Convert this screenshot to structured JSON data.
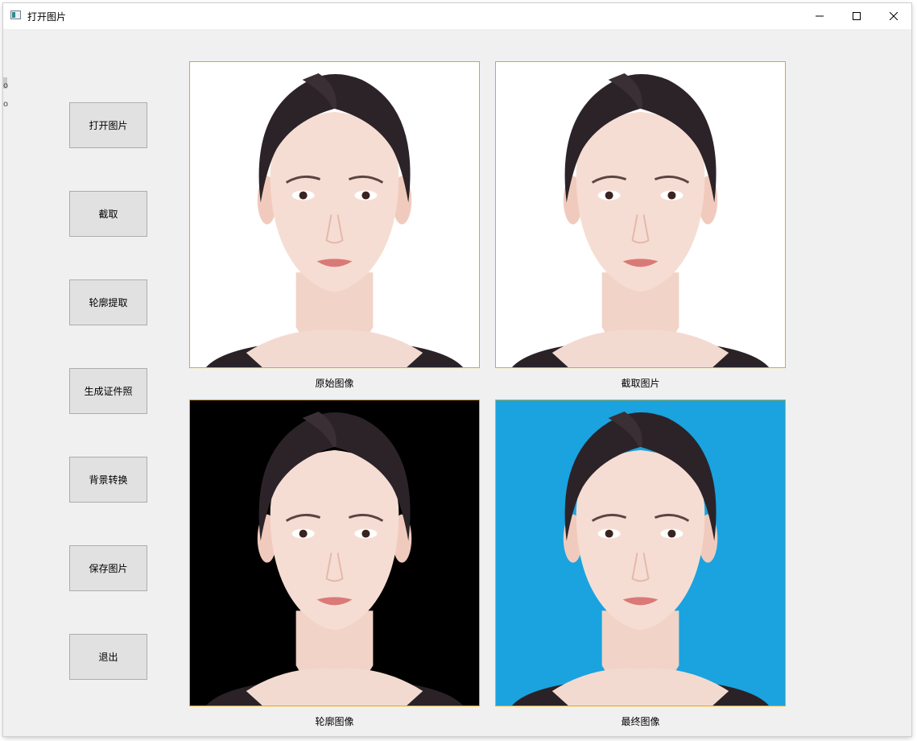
{
  "window": {
    "title": "打开图片"
  },
  "edge_fragments": [
    "o",
    "o"
  ],
  "buttons": {
    "open": "打开图片",
    "crop": "截取",
    "contour": "轮廓提取",
    "id_photo": "生成证件照",
    "bg_convert": "背景转换",
    "save": "保存图片",
    "exit": "退出"
  },
  "panels": {
    "original": {
      "caption": "原始图像",
      "background": "#ffffff"
    },
    "cropped": {
      "caption": "截取图片",
      "background": "#ffffff"
    },
    "contour": {
      "caption": "轮廓图像",
      "background": "#000000"
    },
    "final": {
      "caption": "最终图像",
      "background": "#1aa3df"
    }
  },
  "colors": {
    "panel_border": "#f0a500",
    "window_bg": "#f0f0f0",
    "button_bg": "#e1e1e1"
  },
  "icons": {
    "app": "app-icon",
    "minimize": "minimize-icon",
    "maximize": "maximize-icon",
    "close": "close-icon"
  }
}
